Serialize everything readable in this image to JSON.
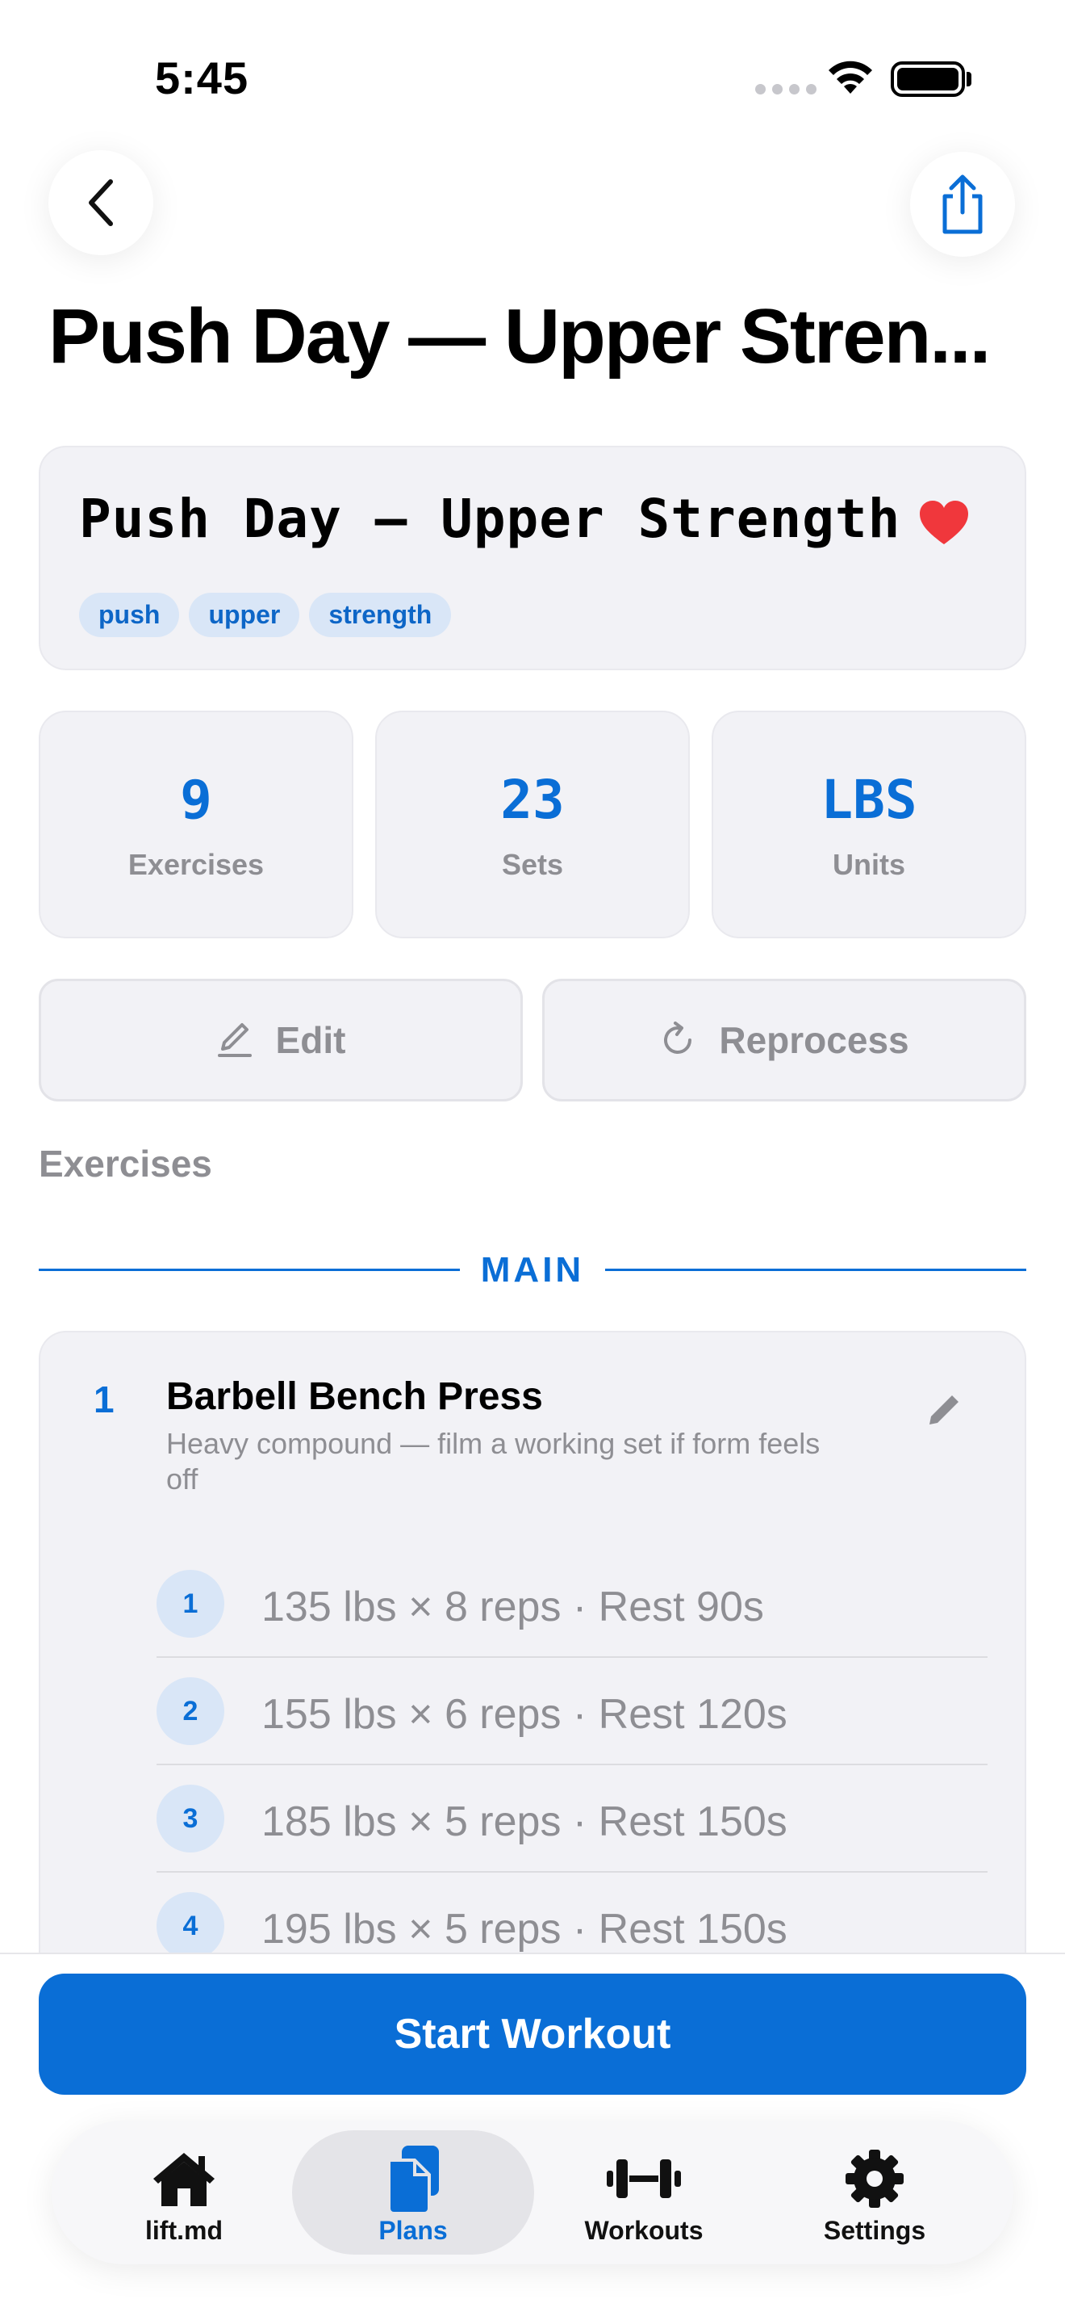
{
  "status_bar": {
    "time": "5:45"
  },
  "nav": {
    "large_title": "Push Day — Upper Stren..."
  },
  "plan": {
    "name": "Push Day — Upper Strength",
    "favorite": true,
    "tags": [
      "push",
      "upper",
      "strength"
    ]
  },
  "stats": [
    {
      "value": "9",
      "label": "Exercises"
    },
    {
      "value": "23",
      "label": "Sets"
    },
    {
      "value": "LBS",
      "label": "Units"
    }
  ],
  "actions": {
    "edit_label": "Edit",
    "reprocess_label": "Reprocess"
  },
  "exercises_section": {
    "label": "Exercises",
    "group_label": "MAIN"
  },
  "exercise": {
    "index": "1",
    "name": "Barbell Bench Press",
    "note": "Heavy compound — film a working set if form feels off",
    "sets": [
      {
        "number": "1",
        "text": "135 lbs × 8 reps · Rest 90s"
      },
      {
        "number": "2",
        "text": "155 lbs × 6 reps · Rest 120s"
      },
      {
        "number": "3",
        "text": "185 lbs × 5 reps · Rest 150s"
      },
      {
        "number": "4",
        "text": "195 lbs × 5 reps · Rest 150s"
      }
    ]
  },
  "start_button": "Start Workout",
  "tabbar": {
    "items": [
      {
        "label": "lift.md",
        "icon": "house-icon"
      },
      {
        "label": "Plans",
        "icon": "document-icon",
        "active": true
      },
      {
        "label": "Workouts",
        "icon": "dumbbell-icon"
      },
      {
        "label": "Settings",
        "icon": "gear-icon"
      }
    ]
  },
  "colors": {
    "accent": "#0a6ed6",
    "heart": "#f0373c",
    "card": "#f2f2f6",
    "secondary_text": "#8e8e93"
  }
}
